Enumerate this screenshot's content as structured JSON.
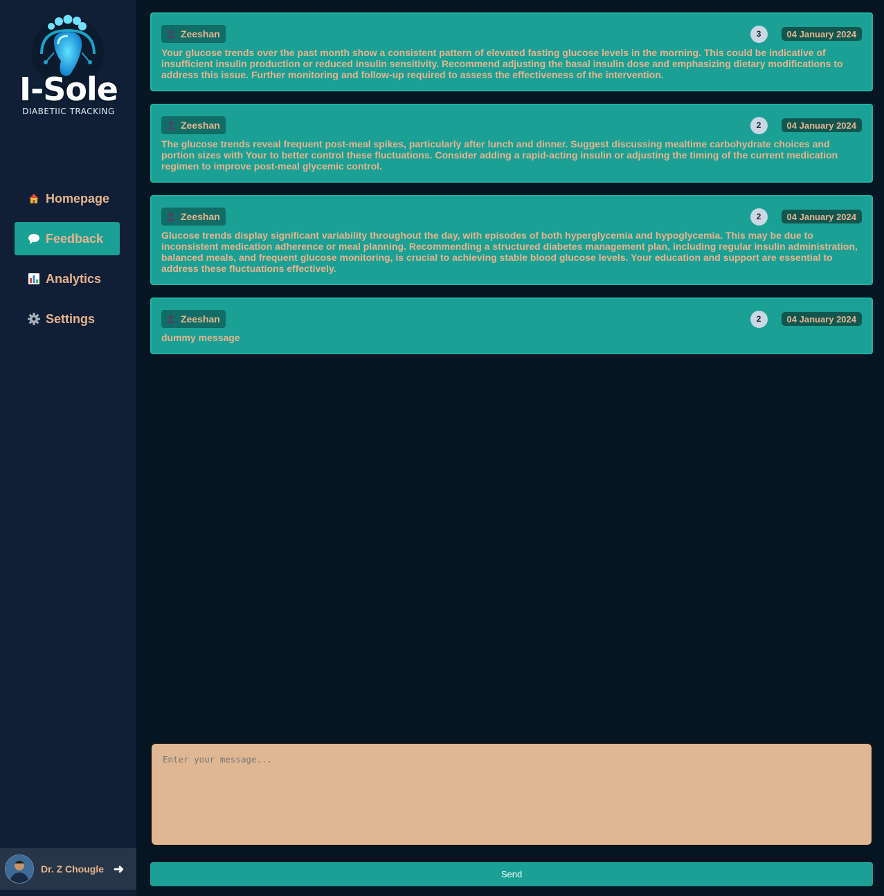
{
  "brand": {
    "name": "I-Sole",
    "tagline": "DIABETIIC TRACKING"
  },
  "nav": {
    "items": [
      {
        "label": "Homepage",
        "icon": "house-icon",
        "active": false
      },
      {
        "label": "Feedback",
        "icon": "speech-bubble-icon",
        "active": true
      },
      {
        "label": "Analytics",
        "icon": "bar-chart-icon",
        "active": false
      },
      {
        "label": "Settings",
        "icon": "gear-icon",
        "active": false
      }
    ]
  },
  "user": {
    "name": "Dr. Z Chougle",
    "logout_icon": "arrow-right-icon"
  },
  "feedback": [
    {
      "author": "Zeeshan",
      "count": "3",
      "date": "04 January 2024",
      "message": "Your glucose trends over the past month show a consistent pattern of elevated fasting glucose levels in the morning. This could be indicative of insufficient insulin production or reduced insulin sensitivity. Recommend adjusting the basal insulin dose and emphasizing dietary modifications to address this issue. Further monitoring and follow-up required to assess the effectiveness of the intervention."
    },
    {
      "author": "Zeeshan",
      "count": "2",
      "date": "04 January 2024",
      "message": "The glucose trends reveal frequent post-meal spikes, particularly after lunch and dinner. Suggest discussing mealtime carbohydrate choices and portion sizes with Your to better control these fluctuations. Consider adding a rapid-acting insulin or adjusting the timing of the current medication regimen to improve post-meal glycemic control."
    },
    {
      "author": "Zeeshan",
      "count": "2",
      "date": "04 January 2024",
      "message": "Glucose trends display significant variability throughout the day, with episodes of both hyperglycemia and hypoglycemia. This may be due to inconsistent medication adherence or meal planning. Recommending a structured diabetes management plan, including regular insulin administration, balanced meals, and frequent glucose monitoring, is crucial to achieving stable blood glucose levels. Your education and support are essential to address these fluctuations effectively."
    },
    {
      "author": "Zeeshan",
      "count": "2",
      "date": "04 January 2024",
      "message": "dummy message"
    }
  ],
  "composer": {
    "placeholder": "Enter your message...",
    "value": ""
  },
  "send_label": "Send",
  "colors": {
    "background": "#051522",
    "sidebar": "#101e36",
    "accent": "#1aa094",
    "text_accent": "#e8b48f",
    "composer_bg": "#dfb793"
  }
}
